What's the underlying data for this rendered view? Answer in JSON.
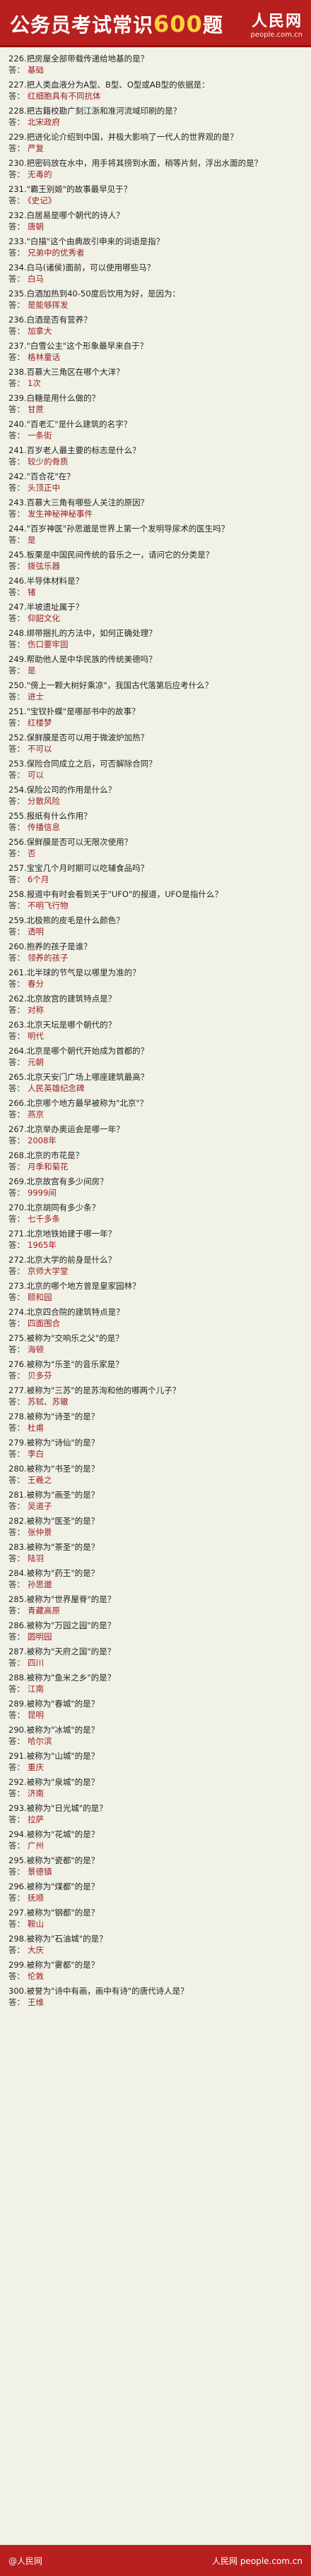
{
  "header": {
    "title_prefix": "公务员考试常识",
    "title_number": "600",
    "title_suffix": "题",
    "logo_text": "人民网",
    "logo_url": "people.com.cn"
  },
  "answer_label": "答：",
  "items": [
    {
      "q": "226.把房屋全部带载传递给地基的是？",
      "a": "基础"
    },
    {
      "q": "227.把人类血液分为A型、B型、O型或AB型的依据是：",
      "a": "红细胞具有不同抗体"
    },
    {
      "q": "228.把古籍校勘广刻江浙和准河流域印刷的是？",
      "a": "北宋政府"
    },
    {
      "q": "229.把进化论介绍到中国，并极大影响了一代人的世界观的是？",
      "a": "严复"
    },
    {
      "q": "230.把密码放在水中，用手将其捞到水面，稍等片刻，浮出水面的是？",
      "a": "无毒的"
    },
    {
      "q": "231.\"霸王别姬\"的故事最早见于？",
      "a": "《史记》"
    },
    {
      "q": "232.白居易是哪个朝代的诗人？",
      "a": "唐朝"
    },
    {
      "q": "233.\"白描\"这个由典故引申来的词语是指？",
      "a": "兄弟中的优秀者"
    },
    {
      "q": "234.白马(诸侯)面前，可以使用哪些马？",
      "a": "白马"
    },
    {
      "q": "235.白酒加热到40-50度后饮用为好，是因为：",
      "a": "是能够挥发"
    },
    {
      "q": "236.白酒是否有营养？",
      "a": "加拿大"
    },
    {
      "q": "237.\"白雪公主\"这个形象最早来自于？",
      "a": "格林童话"
    },
    {
      "q": "238.百慕大三角区在哪个大洋？",
      "a": "1次"
    },
    {
      "q": "239.白糖是用什么做的？",
      "a": "甘蔗"
    },
    {
      "q": "240.\"百老汇\"是什么建筑的名字？",
      "a": "一条街"
    },
    {
      "q": "241.百岁老人最主要的标志是什么？",
      "a": "较少的骨质"
    },
    {
      "q": "242.\"百合花\"在？",
      "a": "头顶正中"
    },
    {
      "q": "243.百慕大三角有哪些人关注的原因？",
      "a": "发生神秘神秘事件"
    },
    {
      "q": "244.\"百岁神医\"孙思邈是世界上第一个发明导尿术的医生吗？",
      "a": "是"
    },
    {
      "q": "245.板栗是中国民间传统的音乐之一，请问它的分类是？",
      "a": "拨弦乐器"
    },
    {
      "q": "246.半导体材料是？",
      "a": "锗"
    },
    {
      "q": "247.半坡遗址属于？",
      "a": "仰韶文化"
    },
    {
      "q": "248.绑带捆扎的方法中，如何正确处理？",
      "a": "伤口要牢固"
    },
    {
      "q": "249.帮助他人是中华民族的传统美德吗？",
      "a": "是"
    },
    {
      "q": "250.\"傍上一颗大树好乘凉\"，我国古代落第后应考什么？",
      "a": "进士"
    },
    {
      "q": "251.\"宝钗扑蝶\"是哪部书中的故事？",
      "a": "红楼梦"
    },
    {
      "q": "252.保鲜膜是否可以用于微波炉加热？",
      "a": "不可以"
    },
    {
      "q": "253.保险合同成立之后，可否解除合同？",
      "a": "可以"
    },
    {
      "q": "254.保险公司的作用是什么？",
      "a": "分散风险"
    },
    {
      "q": "255.报纸有什么作用？",
      "a": "传播信息"
    },
    {
      "q": "256.保鲜膜是否可以无限次使用？",
      "a": "否"
    },
    {
      "q": "257.宝宝几个月时期可以吃辅食品吗？",
      "a": "6个月"
    },
    {
      "q": "258.报道中有时会看到关于\"UFO\"的报道，UFO是指什么？",
      "a": "不明飞行物"
    },
    {
      "q": "259.北极熊的皮毛是什么颜色？",
      "a": "透明"
    },
    {
      "q": "260.抱养的孩子是谁？",
      "a": "领养的孩子"
    },
    {
      "q": "261.北半球的节气是以哪里为准的？",
      "a": "春分"
    },
    {
      "q": "262.北京故宫的建筑特点是？",
      "a": "对称"
    },
    {
      "q": "263.北京天坛是哪个朝代的？",
      "a": "明代"
    },
    {
      "q": "264.北京是哪个朝代开始成为首都的？",
      "a": "元朝"
    },
    {
      "q": "265.北京天安门广场上哪座建筑最高？",
      "a": "人民英雄纪念碑"
    },
    {
      "q": "266.北京哪个地方最早被称为\"北京\"？",
      "a": "燕京"
    },
    {
      "q": "267.北京举办奥运会是哪一年？",
      "a": "2008年"
    },
    {
      "q": "268.北京的市花是？",
      "a": "月季和菊花"
    },
    {
      "q": "269.北京故宫有多少间房？",
      "a": "9999间"
    },
    {
      "q": "270.北京胡同有多少条？",
      "a": "七千多条"
    },
    {
      "q": "271.北京地铁始建于哪一年？",
      "a": "1965年"
    },
    {
      "q": "272.北京大学的前身是什么？",
      "a": "京师大学堂"
    },
    {
      "q": "273.北京的哪个地方曾是皇家园林？",
      "a": "颐和园"
    },
    {
      "q": "274.北京四合院的建筑特点是？",
      "a": "四面围合"
    },
    {
      "q": "275.被称为\"交响乐之父\"的是？",
      "a": "海顿"
    },
    {
      "q": "276.被称为\"乐圣\"的音乐家是？",
      "a": "贝多芬"
    },
    {
      "q": "277.被称为\"三苏\"的是苏洵和他的哪两个儿子？",
      "a": "苏轼、苏辙"
    },
    {
      "q": "278.被称为\"诗圣\"的是？",
      "a": "杜甫"
    },
    {
      "q": "279.被称为\"诗仙\"的是？",
      "a": "李白"
    },
    {
      "q": "280.被称为\"书圣\"的是？",
      "a": "王羲之"
    },
    {
      "q": "281.被称为\"画圣\"的是？",
      "a": "吴道子"
    },
    {
      "q": "282.被称为\"医圣\"的是？",
      "a": "张仲景"
    },
    {
      "q": "283.被称为\"茶圣\"的是？",
      "a": "陆羽"
    },
    {
      "q": "284.被称为\"药王\"的是？",
      "a": "孙思邈"
    },
    {
      "q": "285.被称为\"世界屋脊\"的是？",
      "a": "青藏高原"
    },
    {
      "q": "286.被称为\"万园之园\"的是？",
      "a": "圆明园"
    },
    {
      "q": "287.被称为\"天府之国\"的是？",
      "a": "四川"
    },
    {
      "q": "288.被称为\"鱼米之乡\"的是？",
      "a": "江南"
    },
    {
      "q": "289.被称为\"春城\"的是？",
      "a": "昆明"
    },
    {
      "q": "290.被称为\"冰城\"的是？",
      "a": "哈尔滨"
    },
    {
      "q": "291.被称为\"山城\"的是？",
      "a": "重庆"
    },
    {
      "q": "292.被称为\"泉城\"的是？",
      "a": "济南"
    },
    {
      "q": "293.被称为\"日光城\"的是？",
      "a": "拉萨"
    },
    {
      "q": "294.被称为\"花城\"的是？",
      "a": "广州"
    },
    {
      "q": "295.被称为\"瓷都\"的是？",
      "a": "景德镇"
    },
    {
      "q": "296.被称为\"煤都\"的是？",
      "a": "抚顺"
    },
    {
      "q": "297.被称为\"钢都\"的是？",
      "a": "鞍山"
    },
    {
      "q": "298.被称为\"石油城\"的是？",
      "a": "大庆"
    },
    {
      "q": "299.被称为\"雾都\"的是？",
      "a": "伦敦"
    },
    {
      "q": "300.被誉为\"诗中有画，画中有诗\"的唐代诗人是？",
      "a": "王维"
    }
  ],
  "footer": {
    "source": "@人民网",
    "credit": "人民网 people.com.cn"
  }
}
